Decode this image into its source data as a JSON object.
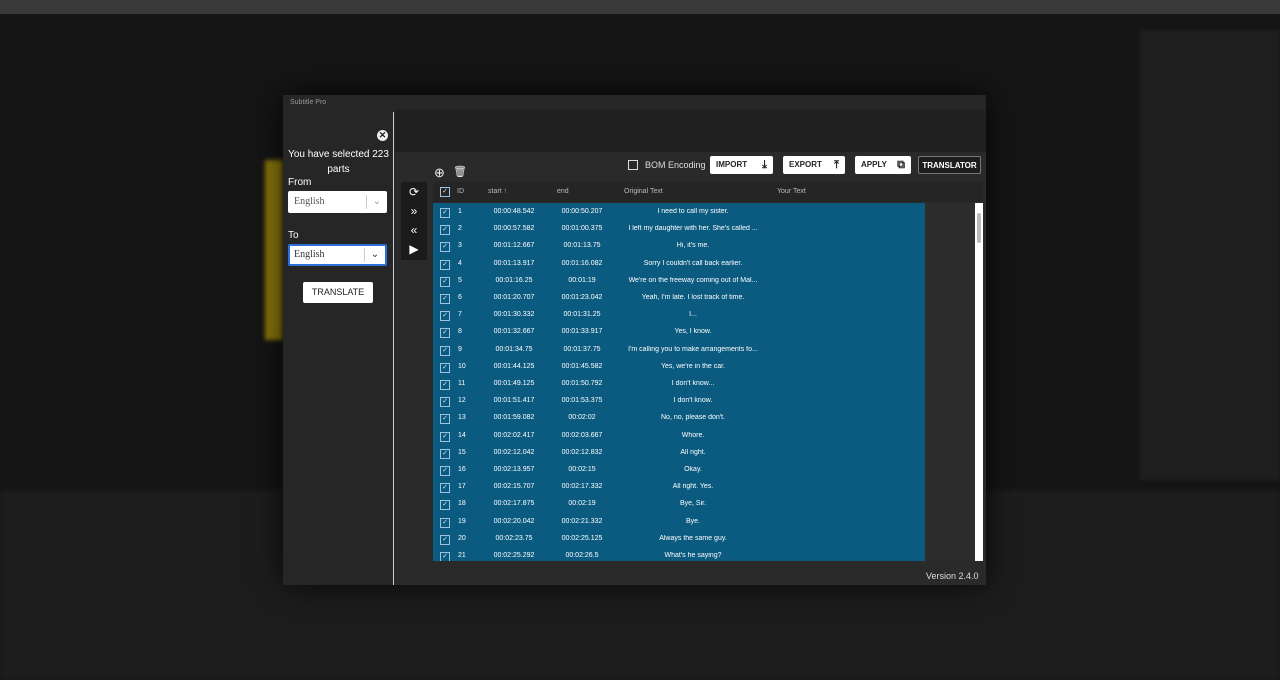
{
  "window": {
    "title": "Subtitle Pro"
  },
  "panel": {
    "selected_text": "You have selected 223 parts",
    "from_label": "From",
    "from_value": "English",
    "to_label": "To",
    "to_value": "English",
    "translate_label": "TRANSLATE"
  },
  "toolbar": {
    "bom_label": "BOM Encoding",
    "import_label": "IMPORT",
    "export_label": "EXPORT",
    "apply_label": "APPLY",
    "translator_label": "TRANSLATOR"
  },
  "table": {
    "headers": {
      "id": "ID",
      "start": "start",
      "end": "end",
      "original": "Original Text",
      "your": "Your Text"
    },
    "rows": [
      {
        "id": "1",
        "start": "00:00:48.542",
        "end": "00:00:50.207",
        "text": "I need to call my sister."
      },
      {
        "id": "2",
        "start": "00:00:57.582",
        "end": "00:01:00.375",
        "text": "I left my daughter with her. She's called ..."
      },
      {
        "id": "3",
        "start": "00:01:12.667",
        "end": "00:01:13.75",
        "text": "Hi, it's me."
      },
      {
        "id": "4",
        "start": "00:01:13.917",
        "end": "00:01:16.082",
        "text": "Sorry I couldn't call back earlier."
      },
      {
        "id": "5",
        "start": "00:01:16.25",
        "end": "00:01:19",
        "text": "We're on the freeway coming out of Mal..."
      },
      {
        "id": "6",
        "start": "00:01:20.707",
        "end": "00:01:23.042",
        "text": "Yeah, I'm late. I lost track of time."
      },
      {
        "id": "7",
        "start": "00:01:30.332",
        "end": "00:01:31.25",
        "text": "I..."
      },
      {
        "id": "8",
        "start": "00:01:32.667",
        "end": "00:01:33.917",
        "text": "Yes, I know."
      },
      {
        "id": "9",
        "start": "00:01:34.75",
        "end": "00:01:37.75",
        "text": "I'm calling you to make arrangements fo..."
      },
      {
        "id": "10",
        "start": "00:01:44.125",
        "end": "00:01:45.582",
        "text": "Yes, we're in the car."
      },
      {
        "id": "11",
        "start": "00:01:49.125",
        "end": "00:01:50.792",
        "text": "I don't know..."
      },
      {
        "id": "12",
        "start": "00:01:51.417",
        "end": "00:01:53.375",
        "text": "I don't know."
      },
      {
        "id": "13",
        "start": "00:01:59.082",
        "end": "00:02:02",
        "text": "No, no, please don't."
      },
      {
        "id": "14",
        "start": "00:02:02.417",
        "end": "00:02:03.667",
        "text": "Whore."
      },
      {
        "id": "15",
        "start": "00:02:12.042",
        "end": "00:02:12.832",
        "text": "All right."
      },
      {
        "id": "16",
        "start": "00:02:13.957",
        "end": "00:02:15",
        "text": "Okay."
      },
      {
        "id": "17",
        "start": "00:02:15.707",
        "end": "00:02:17.332",
        "text": "All right. Yes."
      },
      {
        "id": "18",
        "start": "00:02:17.875",
        "end": "00:02:19",
        "text": "Bye, Sir."
      },
      {
        "id": "19",
        "start": "00:02:20.042",
        "end": "00:02:21.332",
        "text": "Bye."
      },
      {
        "id": "20",
        "start": "00:02:23.75",
        "end": "00:02:25.125",
        "text": "Always the same guy."
      },
      {
        "id": "21",
        "start": "00:02:25.292",
        "end": "00:02:26.5",
        "text": "What's he saying?"
      }
    ]
  },
  "footer": {
    "version": "Version 2.4.0"
  }
}
